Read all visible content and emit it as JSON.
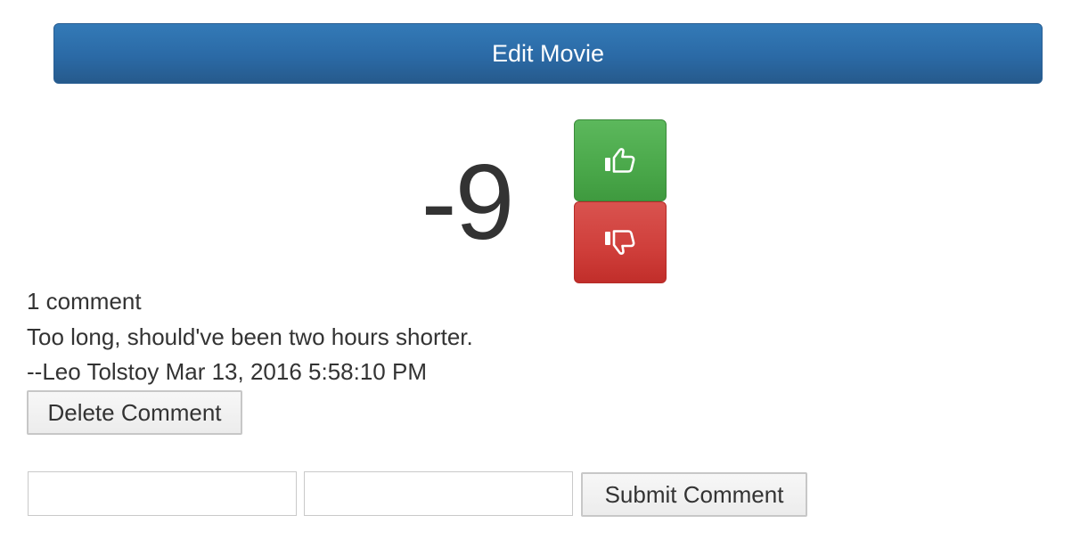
{
  "header": {
    "edit_label": "Edit Movie"
  },
  "votes": {
    "score": "-9",
    "up_icon": "thumbs-up-icon",
    "down_icon": "thumbs-down-icon",
    "up_color": "#5cb85c",
    "down_color": "#d9534f"
  },
  "comments": {
    "count_label": "1 comment",
    "items": [
      {
        "text": "Too long, should've been two hours shorter.",
        "meta": "--Leo Tolstoy Mar 13, 2016 5:58:10 PM",
        "delete_label": "Delete Comment"
      }
    ]
  },
  "form": {
    "author_value": "",
    "author_placeholder": "",
    "comment_value": "",
    "comment_placeholder": "",
    "submit_label": "Submit Comment"
  },
  "colors": {
    "primary": "#337ab7",
    "success": "#5cb85c",
    "danger": "#d9534f"
  }
}
